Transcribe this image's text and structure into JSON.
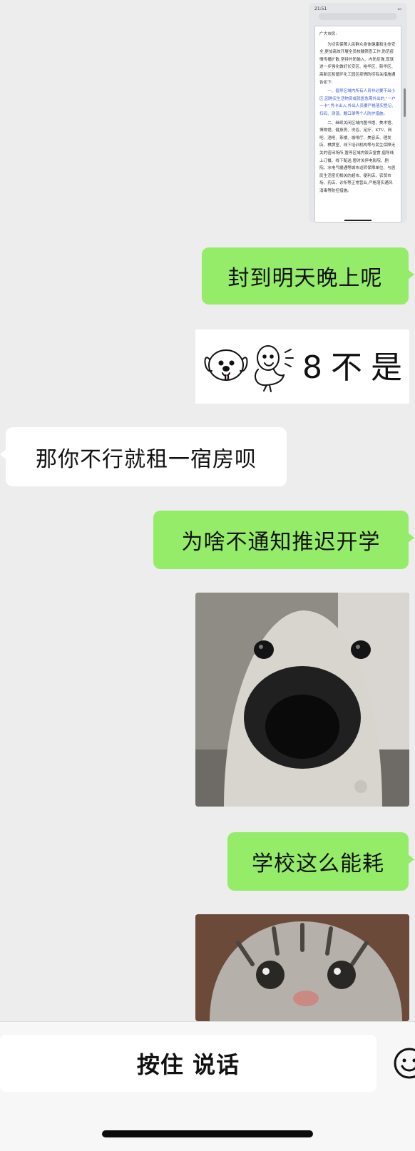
{
  "messages": [
    {
      "id": "m1",
      "side": "right",
      "type": "image",
      "kind": "screenshot"
    },
    {
      "id": "m2",
      "side": "right",
      "type": "text",
      "text": "封到明天晚上呢"
    },
    {
      "id": "m3",
      "side": "right",
      "type": "sticker",
      "text": "8不是"
    },
    {
      "id": "m4",
      "side": "left",
      "type": "text",
      "text": "那你不行就租一宿房呗"
    },
    {
      "id": "m5",
      "side": "right",
      "type": "text",
      "text": "为啥不通知推迟开学"
    },
    {
      "id": "m6",
      "side": "right",
      "type": "image",
      "kind": "dog-photo"
    },
    {
      "id": "m7",
      "side": "right",
      "type": "text",
      "text": "学校这么能耗"
    },
    {
      "id": "m8",
      "side": "right",
      "type": "image",
      "kind": "cat-photo"
    }
  ],
  "screenshot": {
    "time": "21:51",
    "salutation": "广大市民:",
    "para1": "为切实保障人民群众身体健康和生命安全,更加高效开展全员核酸筛查工作,防范疫情传播扩散,坚持外防输入、内防反弹,现就进一步强化做好长安区、裕华区、新华区、高新区和循环化工园区疫情防控有关措施通告如下:",
    "para2": "一、倡导区域内所有人员非必要不出小区,因购买生活物资或就医急需外出的,\"一户一卡\",凭卡出入,外出人员要严格落实登记、扫码、测温、戴口罩等个人防护措施。",
    "para3": "二、继续关闭区域内图书馆、美术馆、博物馆、健身房、洗浴、足疗、KTV、网吧、酒吧、茶楼、咖啡厅、美容店、理发店、棋牌室、线下培训机构等与民生保障无关的密闭场所,暂停区域内饭店堂食,倡导线上订餐、线下配送;暂时关停电影院、剧院。水电气暖通等城市运转保障单位、与居民生活密切相关的超市、便利店、农贸市场、药店、诊所等正常营业,严格落实通风消毒等防控措施。"
  },
  "input_bar": {
    "hold_to_talk": "按住 说话"
  },
  "colors": {
    "chat_background": "#ededed",
    "sent_bubble": "#95ec69",
    "received_bubble": "#ffffff",
    "input_bar_background": "#f7f7f7"
  },
  "icons": {
    "emoji": "smiley-face-icon"
  }
}
